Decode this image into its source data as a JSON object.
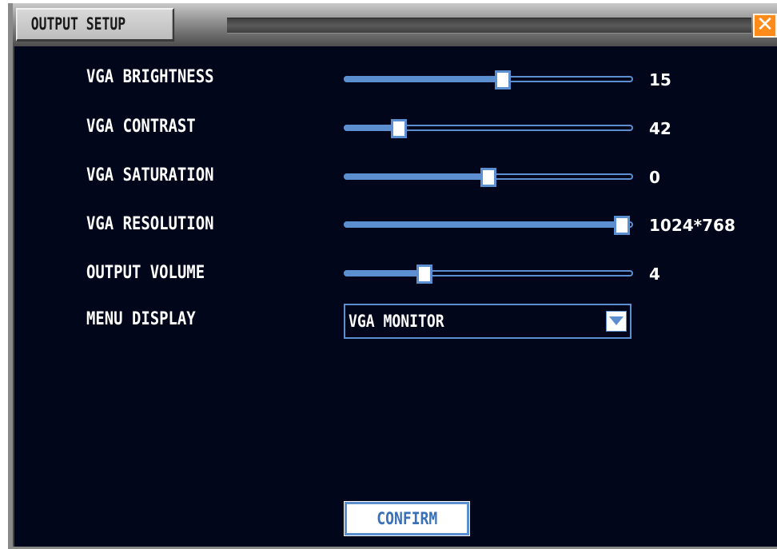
{
  "window": {
    "title": "OUTPUT SETUP",
    "close_icon": "close-icon"
  },
  "colors": {
    "background": "#01061a",
    "accent": "#5b8fd0",
    "close": "#ff8c1a"
  },
  "settings": [
    {
      "label": "VGA BRIGHTNESS",
      "value": "15",
      "level": 0.55
    },
    {
      "label": "VGA CONTRAST",
      "value": "42",
      "level": 0.19
    },
    {
      "label": "VGA SATURATION",
      "value": "0",
      "level": 0.5
    },
    {
      "label": "VGA RESOLUTION",
      "value": "1024*768",
      "level": 0.96
    },
    {
      "label": "OUTPUT VOLUME",
      "value": "4",
      "level": 0.28
    }
  ],
  "menu_display": {
    "label": "MENU DISPLAY",
    "value": "VGA MONITOR",
    "arrow_icon": "triangle-down-icon"
  },
  "confirm_label": "CONFIRM"
}
